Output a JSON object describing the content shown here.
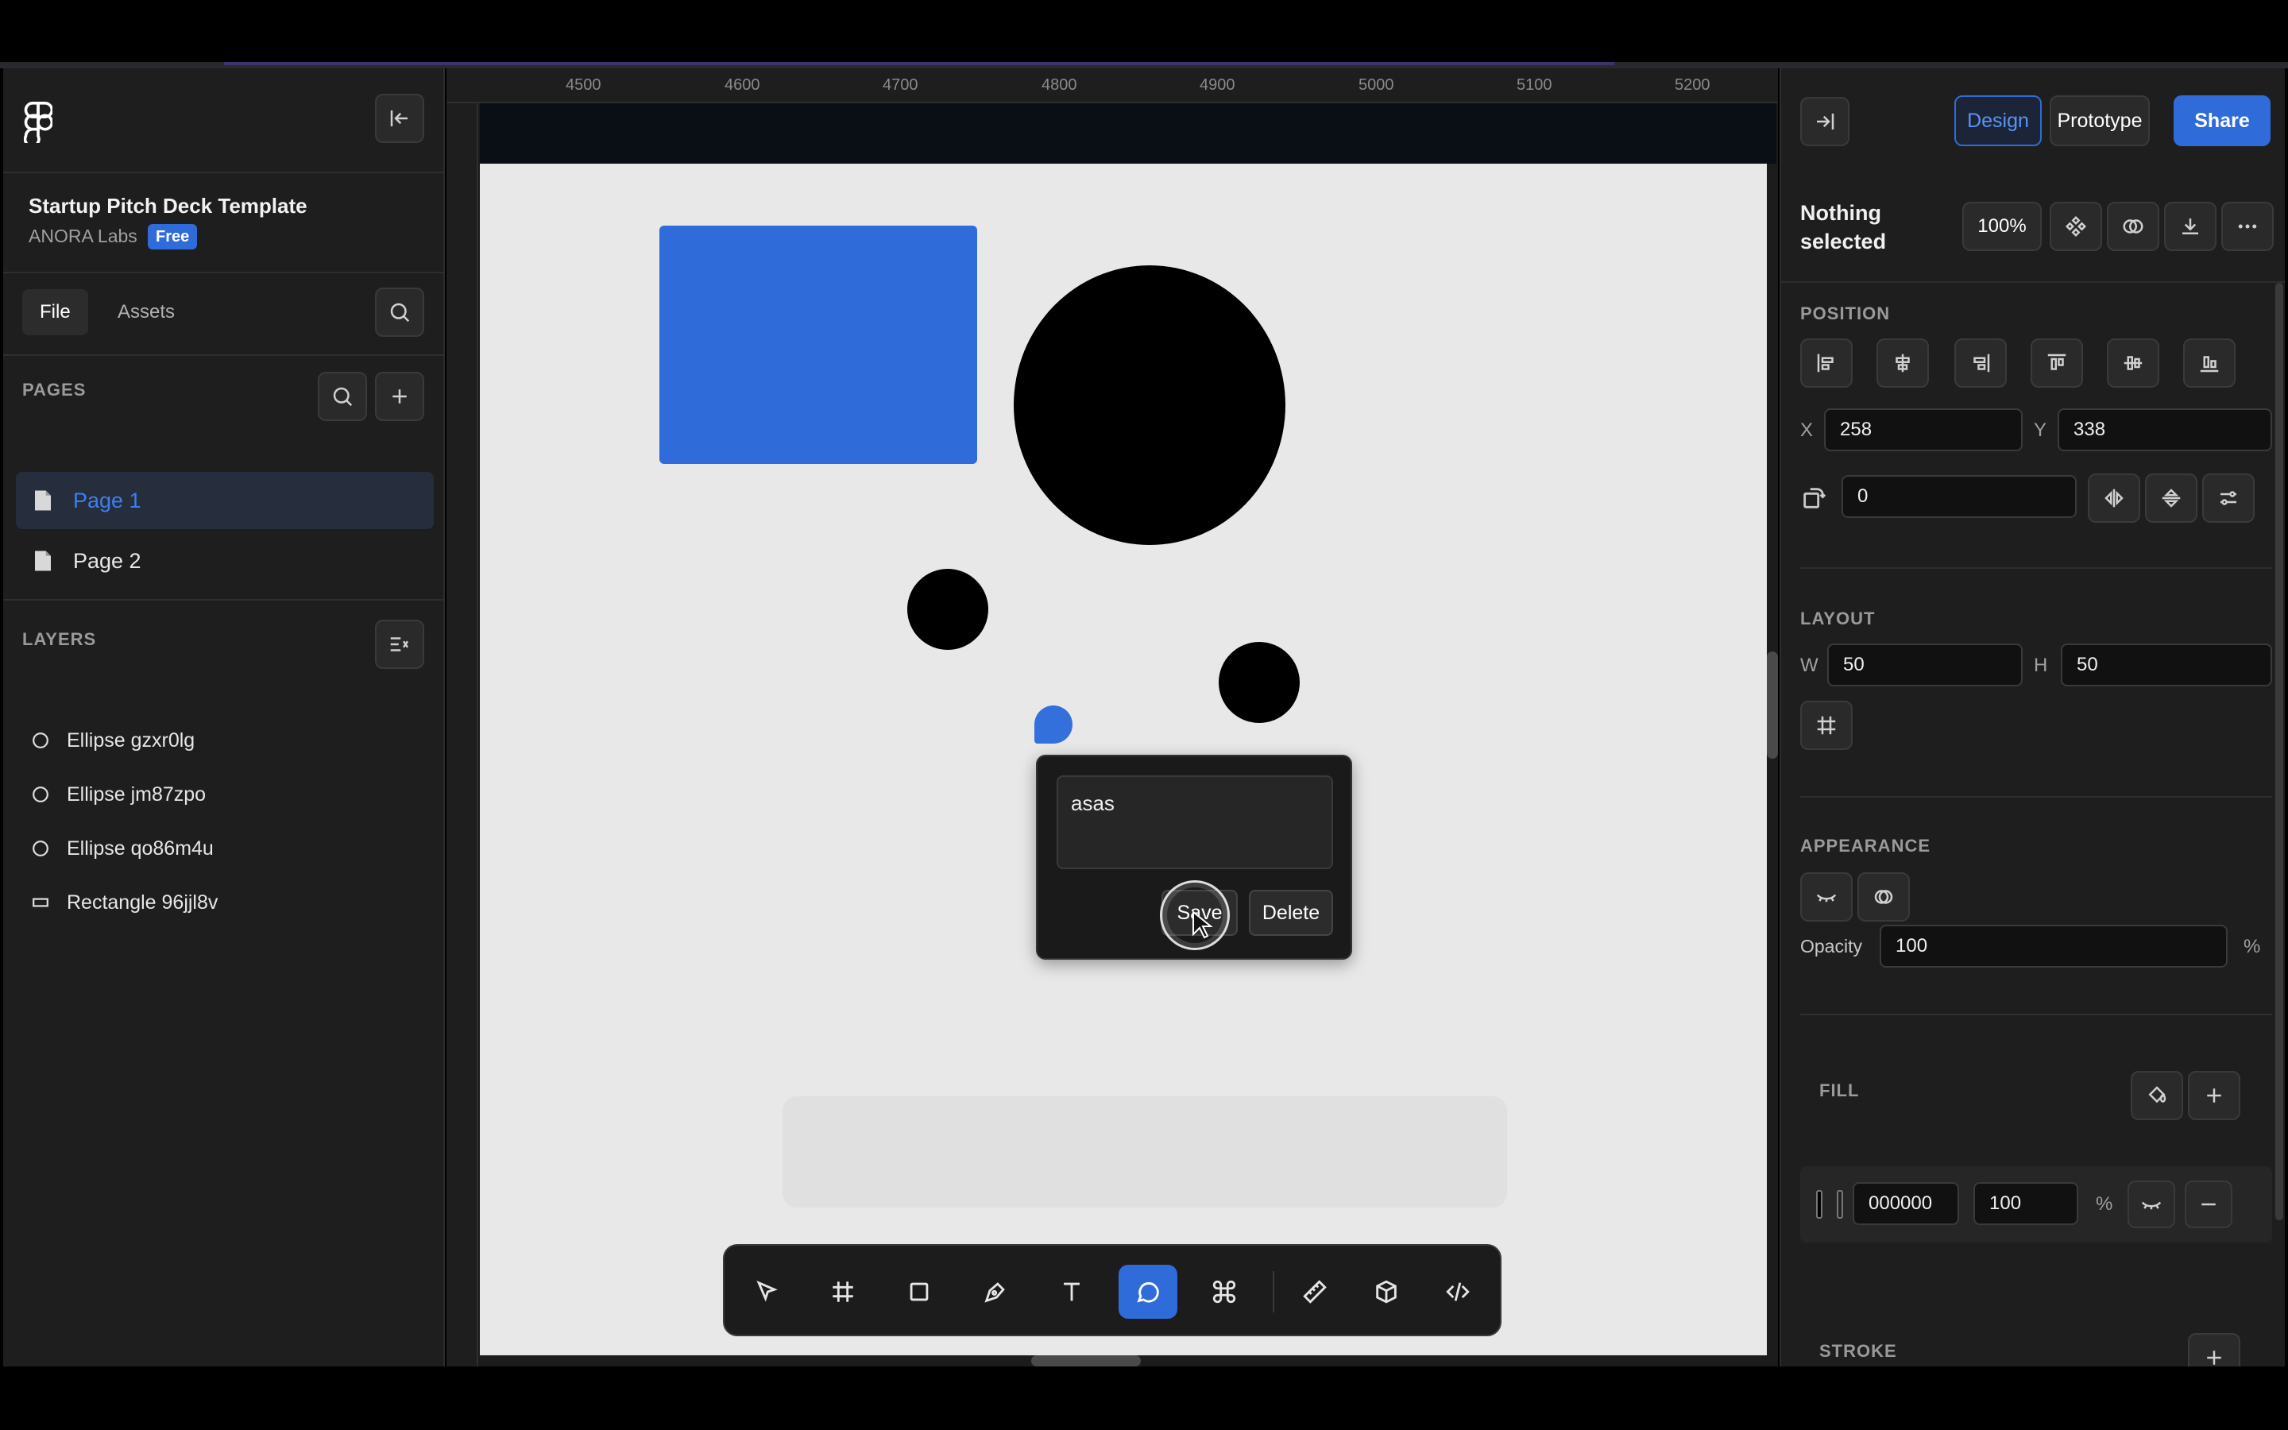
{
  "app": {
    "project_title": "Startup Pitch Deck Template",
    "org_name": "ANORA Labs",
    "plan_badge": "Free"
  },
  "left_tabs": {
    "file": "File",
    "assets": "Assets"
  },
  "pages": {
    "label": "PAGES",
    "items": [
      {
        "label": "Page 1",
        "active": true
      },
      {
        "label": "Page 2",
        "active": false
      }
    ]
  },
  "layers": {
    "label": "LAYERS",
    "items": [
      {
        "label": "Ellipse gzxr0lg",
        "icon": "ellipse-icon"
      },
      {
        "label": "Ellipse jm87zpo",
        "icon": "ellipse-icon"
      },
      {
        "label": "Ellipse qo86m4u",
        "icon": "ellipse-icon"
      },
      {
        "label": "Rectangle 96jjl8v",
        "icon": "rectangle-icon"
      }
    ]
  },
  "ruler": {
    "ticks": [
      "4500",
      "4600",
      "4700",
      "4800",
      "4900",
      "5000",
      "5100",
      "5200"
    ]
  },
  "comment": {
    "text": "asas",
    "save_label": "Save",
    "delete_label": "Delete"
  },
  "toolbar": {
    "tools": [
      "select-tool",
      "frame-tool",
      "rectangle-tool",
      "pen-tool",
      "text-tool",
      "comment-tool",
      "command-tool",
      "ruler-tool",
      "3d-tool",
      "code-tool"
    ],
    "active_tool": "comment-tool"
  },
  "header": {
    "design_label": "Design",
    "prototype_label": "Prototype",
    "share_label": "Share"
  },
  "selection": {
    "status": "Nothing selected",
    "zoom": "100%"
  },
  "position": {
    "label": "POSITION",
    "x_label": "X",
    "x": "258",
    "y_label": "Y",
    "y": "338",
    "rotation": "0"
  },
  "layout": {
    "label": "LAYOUT",
    "w_label": "W",
    "w": "50",
    "h_label": "H",
    "h": "50"
  },
  "appearance": {
    "label": "APPEARANCE",
    "opacity_label": "Opacity",
    "opacity": "100",
    "unit": "%"
  },
  "fill": {
    "label": "FILL",
    "hex": "000000",
    "opacity": "100",
    "unit": "%"
  },
  "stroke": {
    "label": "STROKE"
  },
  "colors": {
    "accent": "#2f6bd9",
    "canvas": "#e8e8e8",
    "panel": "#1e1e1e",
    "shape_black": "#000000",
    "shape_blue": "#2f6bd9"
  }
}
